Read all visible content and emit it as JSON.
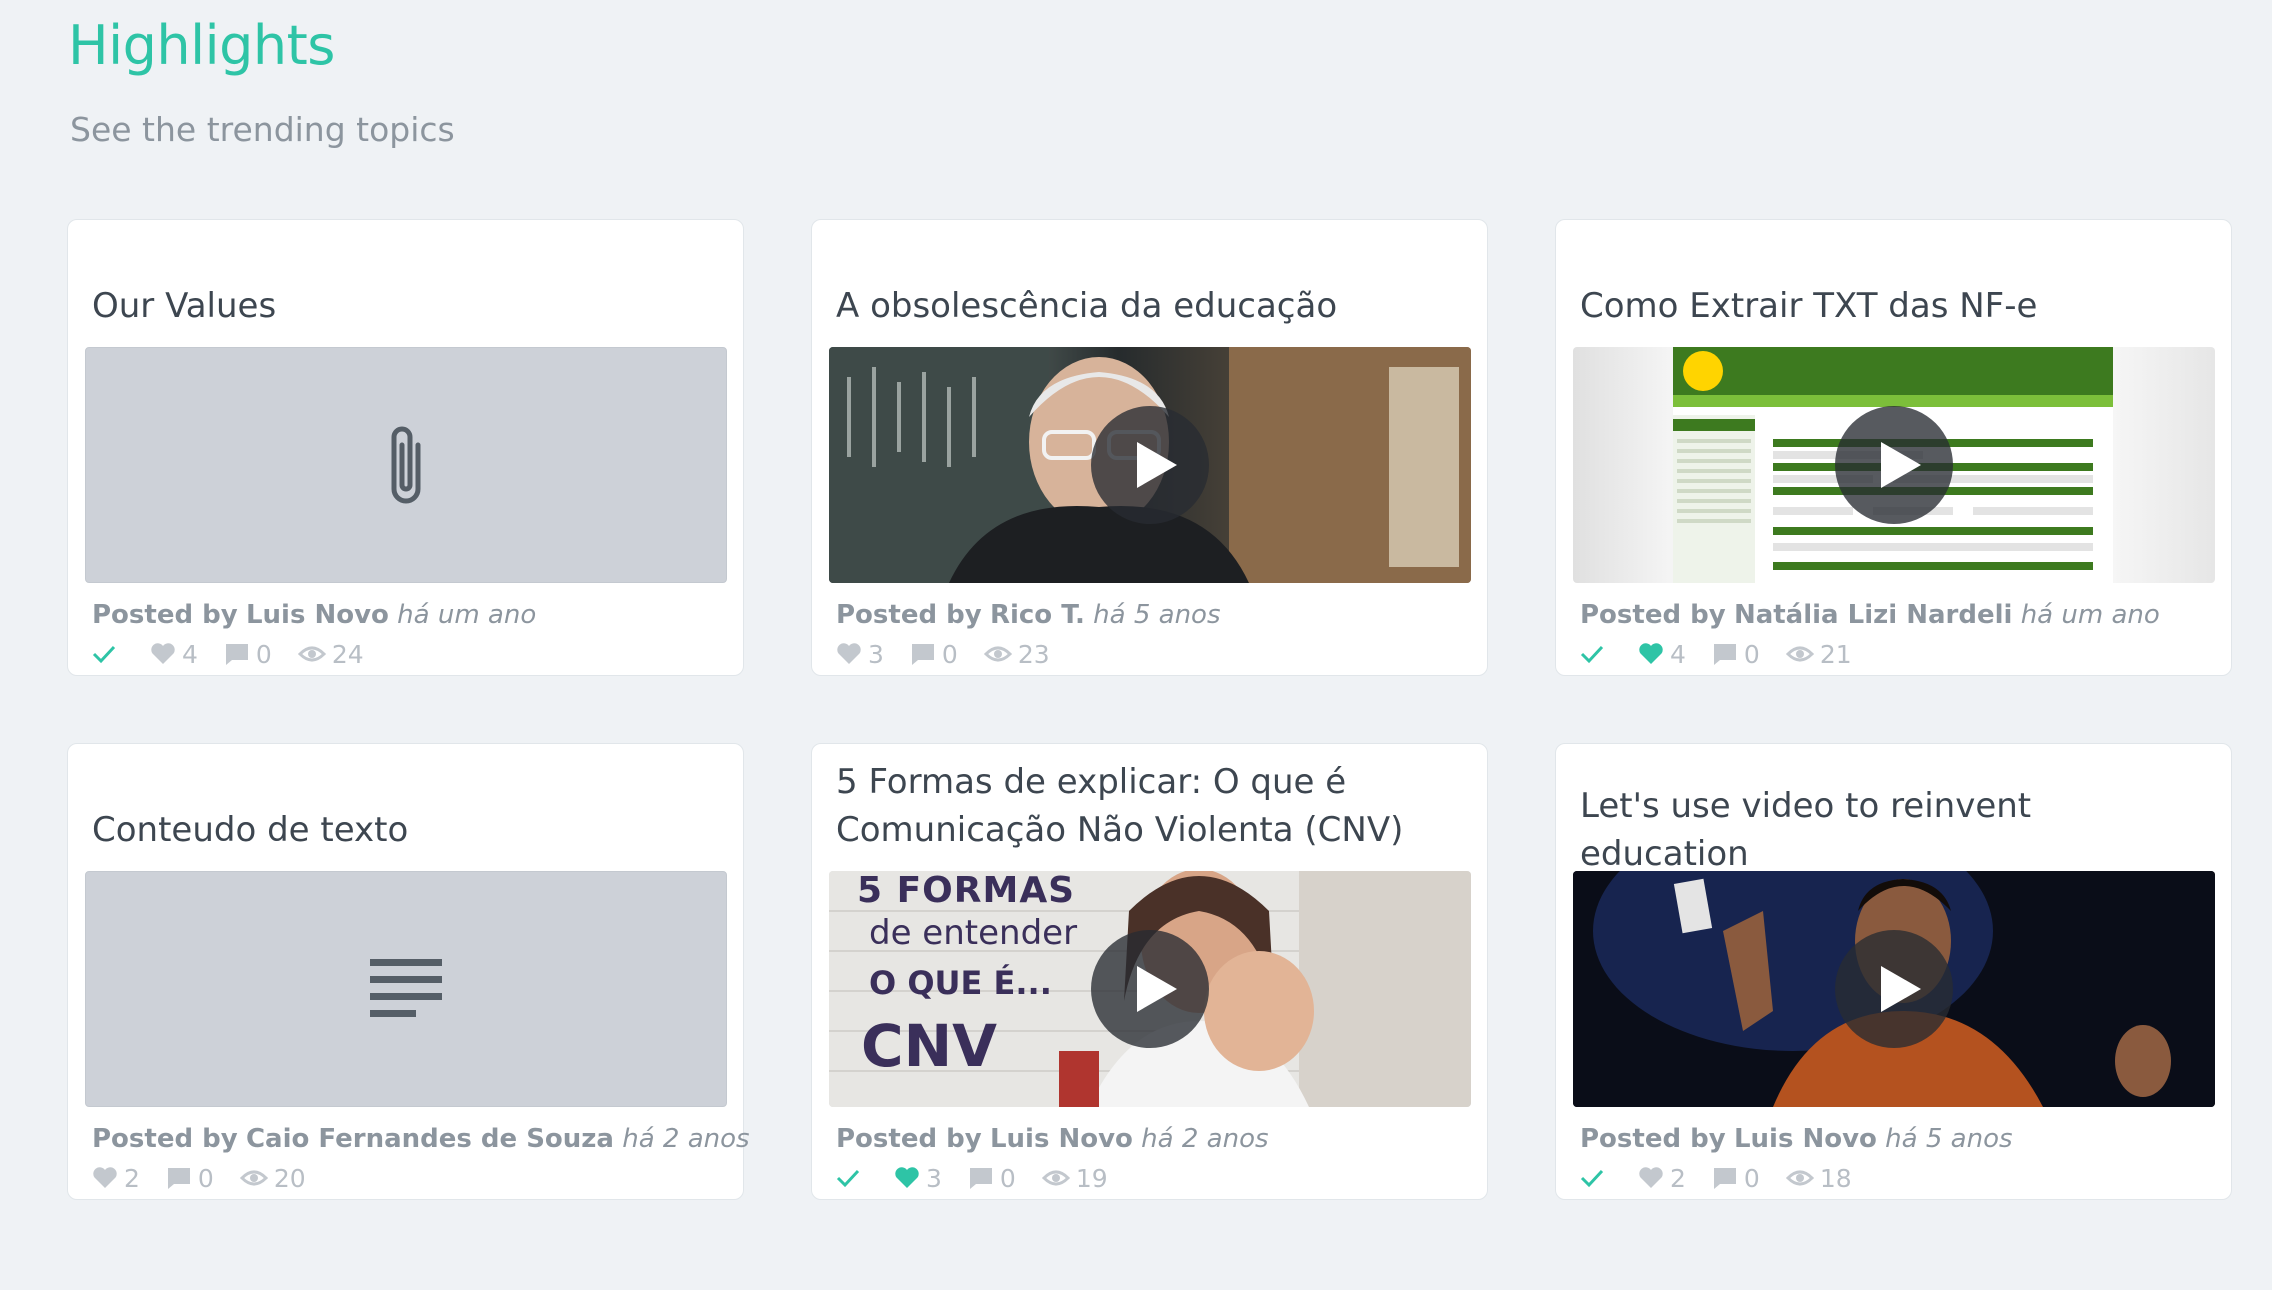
{
  "header": {
    "title": "Highlights",
    "subtitle": "See the trending topics"
  },
  "colors": {
    "accent": "#2ec4a6",
    "muted": "#8c959e",
    "icon_grey": "#b8bec5",
    "background": "#eff2f5"
  },
  "icons": {
    "check": "check-icon",
    "like": "heart-icon",
    "comments": "comment-icon",
    "views": "eye-icon",
    "attachment": "paperclip-icon",
    "text": "text-lines-icon",
    "play": "play-icon"
  },
  "cards": [
    {
      "title": "Our Values",
      "media_type": "attachment",
      "posted_by_label": "Posted by",
      "author": "Luis Novo",
      "time_ago": "há um ano",
      "checked": true,
      "liked": false,
      "likes": "4",
      "comments": "0",
      "views": "24"
    },
    {
      "title": "A obsolescência da educação",
      "media_type": "video",
      "posted_by_label": "Posted by",
      "author": "Rico T.",
      "time_ago": "há 5 anos",
      "checked": false,
      "liked": false,
      "likes": "3",
      "comments": "0",
      "views": "23"
    },
    {
      "title": "Como Extrair TXT das NF-e",
      "media_type": "video",
      "posted_by_label": "Posted by",
      "author": "Natália Lizi Nardeli",
      "time_ago": "há um ano",
      "checked": true,
      "liked": true,
      "likes": "4",
      "comments": "0",
      "views": "21"
    },
    {
      "title": "Conteudo de texto",
      "media_type": "text",
      "posted_by_label": "Posted by",
      "author": "Caio Fernandes de Souza",
      "time_ago": "há 2 anos",
      "checked": false,
      "liked": false,
      "likes": "2",
      "comments": "0",
      "views": "20"
    },
    {
      "title": "5 Formas de explicar: O que é Comunicação Não Violenta (CNV)",
      "media_type": "video",
      "posted_by_label": "Posted by",
      "author": "Luis Novo",
      "time_ago": "há 2 anos",
      "checked": true,
      "liked": true,
      "likes": "3",
      "comments": "0",
      "views": "19"
    },
    {
      "title": "Let's use video to reinvent education",
      "media_type": "video",
      "posted_by_label": "Posted by",
      "author": "Luis Novo",
      "time_ago": "há 5 anos",
      "checked": true,
      "liked": false,
      "likes": "2",
      "comments": "0",
      "views": "18"
    }
  ]
}
